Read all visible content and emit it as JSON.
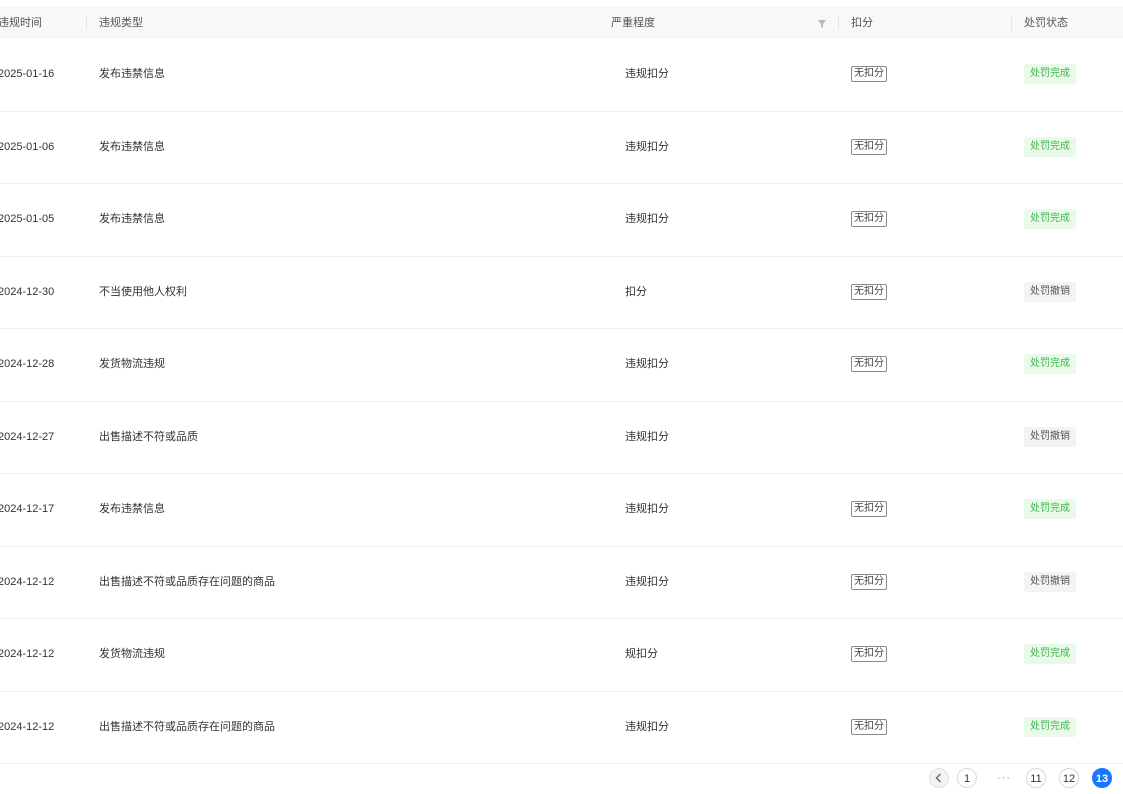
{
  "table": {
    "headers": {
      "date": "违规时间",
      "type": "违规类型",
      "severity": "严重程度",
      "points": "扣分",
      "status": "处罚状态"
    },
    "rows": [
      {
        "date": "2025-01-16",
        "type": "发布违禁信息",
        "severity": "违规扣分",
        "points": "无扣分",
        "status": "处罚完成",
        "status_kind": "done"
      },
      {
        "date": "2025-01-06",
        "type": "发布违禁信息",
        "severity": "违规扣分",
        "points": "无扣分",
        "status": "处罚完成",
        "status_kind": "done"
      },
      {
        "date": "2025-01-05",
        "type": "发布违禁信息",
        "severity": "违规扣分",
        "points": "无扣分",
        "status": "处罚完成",
        "status_kind": "done"
      },
      {
        "date": "2024-12-30",
        "type": "不当使用他人权利",
        "severity": "扣分",
        "points": "无扣分",
        "status": "处罚撤销",
        "status_kind": "revoked"
      },
      {
        "date": "2024-12-28",
        "type": "发货物流违规",
        "severity": "违规扣分",
        "points": "无扣分",
        "status": "处罚完成",
        "status_kind": "done"
      },
      {
        "date": "2024-12-27",
        "type": "出售描述不符或品质",
        "severity": "违规扣分",
        "points": "",
        "status": "处罚撤销",
        "status_kind": "revoked"
      },
      {
        "date": "2024-12-17",
        "type": "发布违禁信息",
        "severity": "违规扣分",
        "points": "无扣分",
        "status": "处罚完成",
        "status_kind": "done"
      },
      {
        "date": "2024-12-12",
        "type": "出售描述不符或品质存在问题的商品",
        "severity": "违规扣分",
        "points": "无扣分",
        "status": "处罚撤销",
        "status_kind": "revoked"
      },
      {
        "date": "2024-12-12",
        "type": "发货物流违规",
        "severity": "规扣分",
        "points": "无扣分",
        "status": "处罚完成",
        "status_kind": "done"
      },
      {
        "date": "2024-12-12",
        "type": "出售描述不符或品质存在问题的商品",
        "severity": "违规扣分",
        "points": "无扣分",
        "status": "处罚完成",
        "status_kind": "done"
      }
    ]
  },
  "pagination": {
    "prev_icon": "chevron-left-icon",
    "pages": [
      "1",
      "11",
      "12",
      "13"
    ],
    "ellipsis": "···",
    "current": "13"
  },
  "colors": {
    "status_done_bg": "#eafaea",
    "status_done_text": "#3cb84a",
    "status_revoked_bg": "#f2f3f5",
    "accent": "#1677ff"
  }
}
